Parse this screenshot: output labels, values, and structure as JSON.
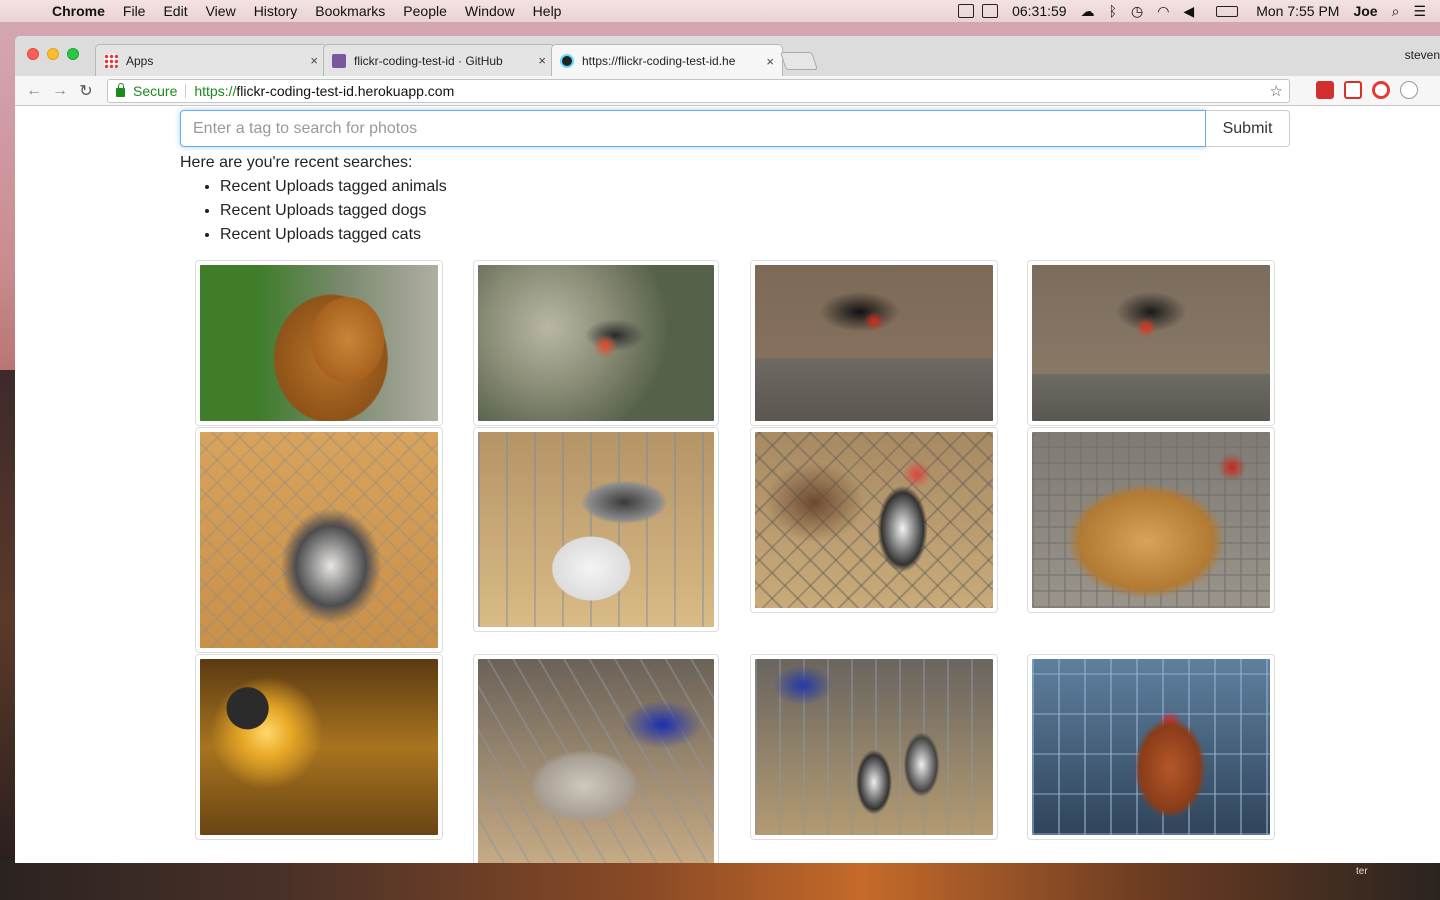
{
  "menubar": {
    "app": "Chrome",
    "items": [
      "File",
      "Edit",
      "View",
      "History",
      "Bookmarks",
      "People",
      "Window",
      "Help"
    ],
    "clock": "06:31:59",
    "datetime": "Mon 7:55 PM",
    "user": "Joe"
  },
  "browser": {
    "tabs": [
      {
        "title": "Apps",
        "close": "×"
      },
      {
        "title": "flickr-coding-test-id · GitHub",
        "close": "×"
      },
      {
        "title": "https://flickr-coding-test-id.he",
        "close": "×"
      }
    ],
    "profile": "steven",
    "secure_label": "Secure",
    "url_scheme": "https://",
    "url_host": "flickr-coding-test-id.herokuapp.com"
  },
  "page": {
    "search_placeholder": "Enter a tag to search for photos",
    "submit_label": "Submit",
    "recent_heading": "Here are you're recent searches:",
    "recent_searches": [
      "Recent Uploads tagged animals",
      "Recent Uploads tagged dogs",
      "Recent Uploads tagged cats"
    ]
  },
  "desktop": {
    "wallpaper_text": "ter"
  }
}
